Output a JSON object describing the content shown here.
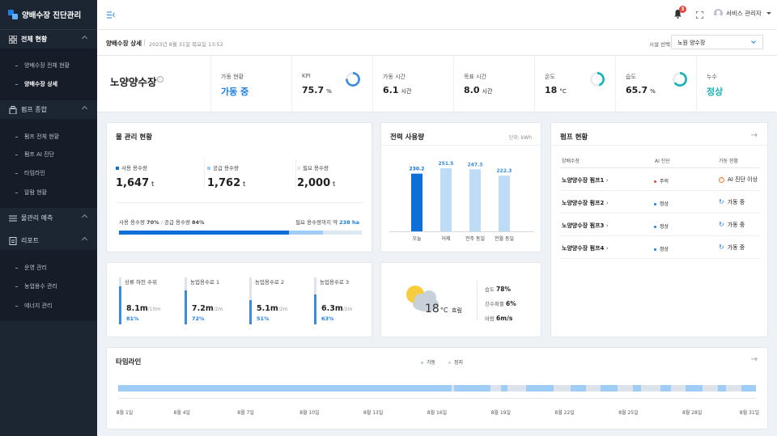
{
  "app": {
    "title": "양배수장 진단관리"
  },
  "sidebar": {
    "sections": [
      {
        "label": "전체 현황",
        "icon": "grid-icon"
      },
      {
        "label": "펌프 종합",
        "icon": "building-icon"
      },
      {
        "label": "물관리 예측",
        "icon": "list-icon"
      },
      {
        "label": "리포트",
        "icon": "document-icon"
      }
    ],
    "overview_items": [
      "양배수장 전체 현황",
      "양배수장 상세"
    ],
    "pump_items": [
      "펌프 전체 현황",
      "펌프 AI 진단",
      "타임라인",
      "알람 현황"
    ],
    "report_items": [
      "운영 관리",
      "농업용수 관리",
      "에너지 관리"
    ]
  },
  "topbar": {
    "notification_count": "3",
    "user_name": "서비스 관리자"
  },
  "subheader": {
    "title": "양배수장 상세",
    "datetime": "2023년 8월 31일 목요일 13:52",
    "facility_label": "시설 선택:",
    "facility_value": "노원 양수장"
  },
  "station": {
    "name": "노양양수장",
    "kpis": [
      {
        "label": "가동 현황",
        "value": "가동 중",
        "unit": ""
      },
      {
        "label": "KPI",
        "value": "75.7",
        "unit": "%"
      },
      {
        "label": "가동 시간",
        "value": "6.1",
        "unit": "시간"
      },
      {
        "label": "목표 시간",
        "value": "8.0",
        "unit": "시간"
      },
      {
        "label": "온도",
        "value": "18",
        "unit": "°C"
      },
      {
        "label": "습도",
        "value": "65.7",
        "unit": "%"
      },
      {
        "label": "누수",
        "value": "정상",
        "unit": ""
      }
    ]
  },
  "water": {
    "title": "물 관리 현황",
    "stats": [
      {
        "label": "사용 용수량",
        "value": "1,647",
        "unit": "t"
      },
      {
        "label": "공급 용수량",
        "value": "1,762",
        "unit": "t"
      },
      {
        "label": "필요 용수량",
        "value": "2,000",
        "unit": "t"
      }
    ],
    "ratio_used_label": "사용 용수량",
    "ratio_used": "70%",
    "ratio_supplied_label": "공급 용수량",
    "ratio_supplied": "84%",
    "remaining_label": "필요 용수량까지 약",
    "remaining_value": "238 ha",
    "progress_used": 0.7,
    "progress_supplied": 0.84
  },
  "gauges": [
    {
      "label": "상류 하천 수위",
      "value": "8.1m",
      "max": "/10m",
      "pct": "81%",
      "level": 0.81
    },
    {
      "label": "농업용수로 1",
      "value": "7.2m",
      "max": "/2m",
      "pct": "72%",
      "level": 0.72
    },
    {
      "label": "농업용수로 2",
      "value": "5.1m",
      "max": "/2m",
      "pct": "51%",
      "level": 0.51
    },
    {
      "label": "농업용수로 3",
      "value": "6.3m",
      "max": "/2m",
      "pct": "63%",
      "level": 0.63
    }
  ],
  "power": {
    "title": "전력 사용량",
    "unit": "단위: kWh",
    "chart_data": {
      "type": "bar",
      "categories": [
        "오늘",
        "어제",
        "전주 동일",
        "전월 동일"
      ],
      "values": [
        230.2,
        251.5,
        247.3,
        222.3
      ],
      "labels": [
        "230.2",
        "251.5",
        "247.3",
        "222.3"
      ],
      "ylim": [
        0,
        300
      ],
      "colors": [
        "#0f6fd8",
        "#bfdcf7",
        "#bfdcf7",
        "#bfdcf7"
      ]
    }
  },
  "weather": {
    "temp": "18",
    "unit": "°C",
    "condition": "흐림",
    "icon": "partly-cloudy-icon",
    "rows": [
      {
        "label": "습도",
        "value": "78%"
      },
      {
        "label": "강수확률",
        "value": "6%"
      },
      {
        "label": "바람",
        "value": "6m/s"
      }
    ]
  },
  "pumps": {
    "title": "펌프 현황",
    "headers": [
      "양배수장",
      "AI 진단",
      "가동 현황"
    ],
    "rows": [
      {
        "name": "노양양수장 펌프1",
        "diag": "주의",
        "diag_color": "#e5483b",
        "status": "AI 진단 이상",
        "status_icon": "warning-icon"
      },
      {
        "name": "노양양수장 펌프2",
        "diag": "정상",
        "diag_color": "#1e7fe6",
        "status": "가동 중",
        "status_icon": "refresh-icon"
      },
      {
        "name": "노양양수장 펌프3",
        "diag": "정상",
        "diag_color": "#1e7fe6",
        "status": "가동 중",
        "status_icon": "refresh-icon"
      },
      {
        "name": "노양양수장 펌프4",
        "diag": "정상",
        "diag_color": "#1e7fe6",
        "status": "가동 중",
        "status_icon": "refresh-icon"
      }
    ]
  },
  "timeline": {
    "title": "타임라인",
    "legend": [
      {
        "label": "가동",
        "color": "#9fcdf5"
      },
      {
        "label": "정지",
        "color": "#dde3ea"
      }
    ],
    "ticks": [
      "8월 1일",
      "8월 4일",
      "8월 7일",
      "8월 10일",
      "8월 13일",
      "8월 16일",
      "8월 19일",
      "8월 22일",
      "8월 25일",
      "8월 28일",
      "8월 31일"
    ],
    "start_day": 1,
    "end_day": 31,
    "running_days": [
      [
        1,
        16.7
      ],
      [
        16.8,
        18.5
      ],
      [
        19,
        19.3
      ],
      [
        20.2,
        21.5
      ],
      [
        22.3,
        23
      ],
      [
        23.7,
        24.5
      ],
      [
        25.2,
        25.6
      ],
      [
        26.5,
        27
      ],
      [
        27.7,
        28.5
      ],
      [
        29.2,
        29.6
      ],
      [
        30.3,
        31
      ]
    ]
  }
}
